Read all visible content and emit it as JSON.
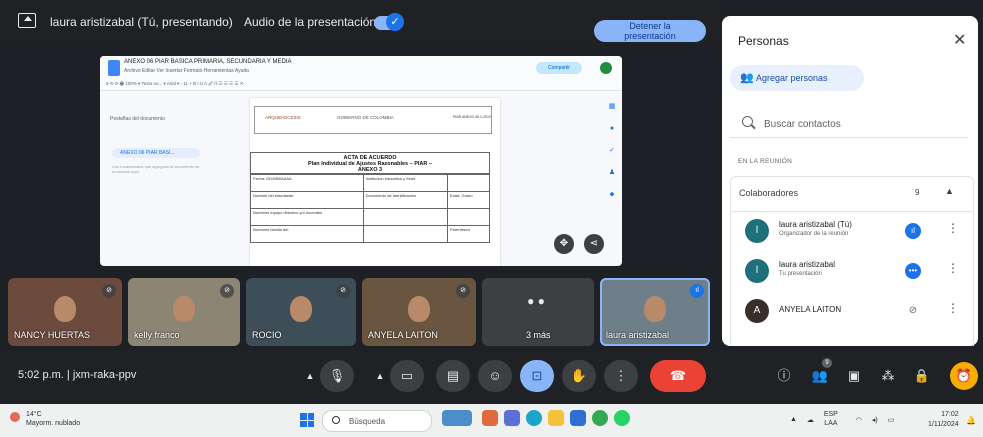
{
  "topbar": {
    "presenter_label": "laura aristizabal (Tú, presentando)",
    "audio_label": "Audio de la presentación",
    "stop_button_line1": "Detener la",
    "stop_button_line2": "presentación"
  },
  "document": {
    "title": "ANEXO 06 PIAR BASICA PRIMARIA, SECUNDARIA Y MEDIA",
    "menu": "Archivo   Editar   Ver   Insertar   Formato   Herramientas   Ayuda",
    "toolbar": "5  ⟲  ⟳  🖶  100%  ▾   Texto no...  ▾   Arial  ▾   -  11  +   B  I  U  A  🖉   ⛓  ☰  ☰  ☰  ☰   ✕",
    "share_label": "Compartir",
    "outline_label": "Pestañas del documento",
    "tab_chip": "ANEXO 06 PIAR BASI...",
    "side_note": "Los encabezados que agregues al documento se mostrarán aquí.",
    "header_logo_left": "ARQUIDIOCESIS",
    "header_logo_right": "GOBIERNO DE COLOMBIA",
    "header_code": "PIAR ANEXO 06 1-2019",
    "acta_line1": "ACTA DE ACUERDO",
    "acta_line2": "Plan Individual de Ajustes Razonables – PIAR –",
    "acta_line3": "ANEXO 3",
    "form_rows": [
      [
        "Fecha: DD/MM/AAAA",
        "Institución educativa y Sede",
        ""
      ],
      [
        "Nombre del estudiante:",
        "Documento de Identificación",
        "Edad: Grado"
      ],
      [
        "Nombres equipo directivo y/o docentes",
        "",
        ""
      ],
      [
        "Nombres      familia      del",
        "",
        "Parentesco"
      ]
    ]
  },
  "panel": {
    "title": "Personas",
    "add_people": "Agregar personas",
    "search_placeholder": "Buscar contactos",
    "section_label": "EN LA REUNIÓN",
    "group_label": "Colaboradores",
    "group_count": "9",
    "participants": [
      {
        "name": "laura aristizabal (Tú)",
        "subtitle": "Organizador de la reunión",
        "initial": "l",
        "avatar_color": "#1e6f7a",
        "status_icon": "audio-level"
      },
      {
        "name": "laura aristizabal",
        "subtitle": "Tu presentación",
        "initial": "l",
        "avatar_color": "#1e6f7a",
        "status_icon": "more"
      },
      {
        "name": "ANYELA LAITON",
        "subtitle": "",
        "initial": "A",
        "avatar_color": "#3a2e2a",
        "status_icon": "mic-off"
      }
    ]
  },
  "tiles": [
    {
      "name": "NANCY HUERTAS",
      "bg": "#6b4b3e"
    },
    {
      "name": "kelly franco",
      "bg": "#8d8574"
    },
    {
      "name": "ROCIO",
      "bg": "#3d4e59"
    },
    {
      "name": "ANYELA LAITON",
      "bg": "#6a5640"
    },
    {
      "name": "3 más",
      "bg": "#3c4043"
    },
    {
      "name": "laura aristizabal",
      "bg": "#6f7f8a"
    }
  ],
  "controls": {
    "time": "5:02 p.m.",
    "separator": "|",
    "meeting_code": "jxm-raka-ppv",
    "people_badge": "9"
  },
  "taskbar": {
    "temperature": "14°C",
    "weather": "Mayorm. nublado",
    "search_placeholder": "Búsqueda",
    "lang_line1": "ESP",
    "lang_line2": "LAA",
    "time": "17:02",
    "date": "1/11/2024"
  },
  "colors": {
    "accent": "#8ab4f8",
    "hangup": "#ea4335",
    "panel_bg": "#ffffff",
    "meet_bg": "#202124"
  }
}
